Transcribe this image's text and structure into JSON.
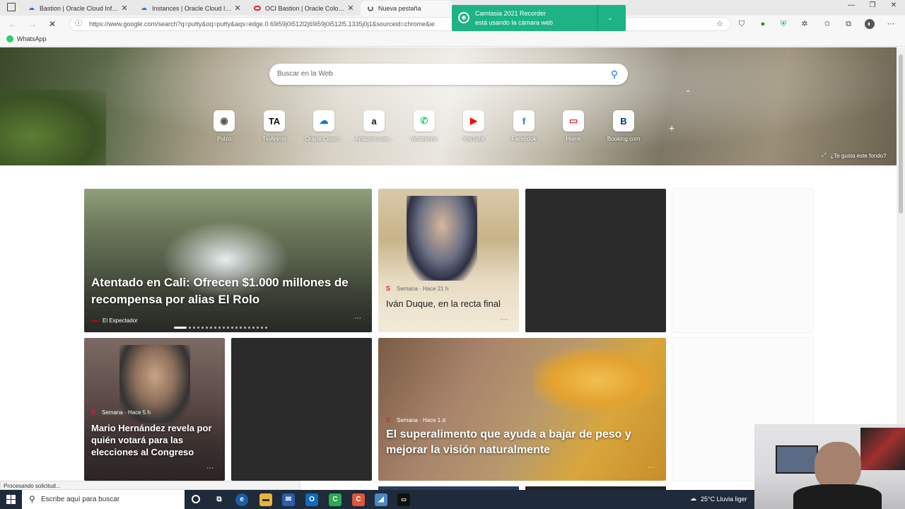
{
  "tabs": [
    {
      "label": "Bastion | Oracle Cloud Infrastruct",
      "icon": "cloud-icon"
    },
    {
      "label": "Instances | Oracle Cloud Infrastru",
      "icon": "cloud-icon"
    },
    {
      "label": "OCI Bastion | Oracle Colombia",
      "icon": "oracle-icon"
    },
    {
      "label": "Nueva pestaña",
      "icon": "loading-icon"
    }
  ],
  "address": {
    "url": "https://www.google.com/search?q=putty&oq=putty&aqs=edge.0.69i59j0i512l2j69i59j0i512l5.1335j0j1&sourceid=chrome&ie"
  },
  "favorites": [
    {
      "label": "WhatsApp"
    }
  ],
  "camtasia": {
    "line1": "Camtasia 2021 Recorder",
    "line2": "está usando la cámara web"
  },
  "search": {
    "placeholder": "Buscar en la Web"
  },
  "quick_links": [
    {
      "label": "Pulzo",
      "glyph": "◉",
      "color": "#555555"
    },
    {
      "label": "TioAnime",
      "glyph": "TA",
      "color": "#111111"
    },
    {
      "label": "Oracle Cloud...",
      "glyph": "☁",
      "color": "#0a78d4"
    },
    {
      "label": "Amazon.com...",
      "glyph": "a",
      "color": "#111111"
    },
    {
      "label": "WhatsApp",
      "glyph": "✆",
      "color": "#25d366"
    },
    {
      "label": "YouTube",
      "glyph": "▶",
      "color": "#ff0000"
    },
    {
      "label": "Facebook",
      "glyph": "f",
      "color": "#1877f2"
    },
    {
      "label": "Home",
      "glyph": "▭",
      "color": "#e0262c"
    },
    {
      "label": "Booking.com",
      "glyph": "B",
      "color": "#003580"
    }
  ],
  "background_prompt": "¿Te gusta este fondo?",
  "cards": {
    "c1": {
      "headline": "Atentado en Cali: Ofrecen $1.000 millones de recompensa por alias El Rolo",
      "source": "El Espectador"
    },
    "c2": {
      "headline": "Iván Duque, en la recta final",
      "source": "Semana · Hace 21 h"
    },
    "c5": {
      "headline": "Mario Hernández revela por quién votará para las elecciones al Congreso",
      "source": "Semana · Hace 5 h"
    },
    "c7": {
      "headline": "El superalimento que ayuda a bajar de peso y mejorar la visión naturalmente",
      "source": "Semana · Hace 1 d"
    }
  },
  "status_text": "Procesando solicitud...",
  "taskbar": {
    "search_placeholder": "Escribe aquí para buscar",
    "weather": "25°C  Lluvia liger"
  }
}
